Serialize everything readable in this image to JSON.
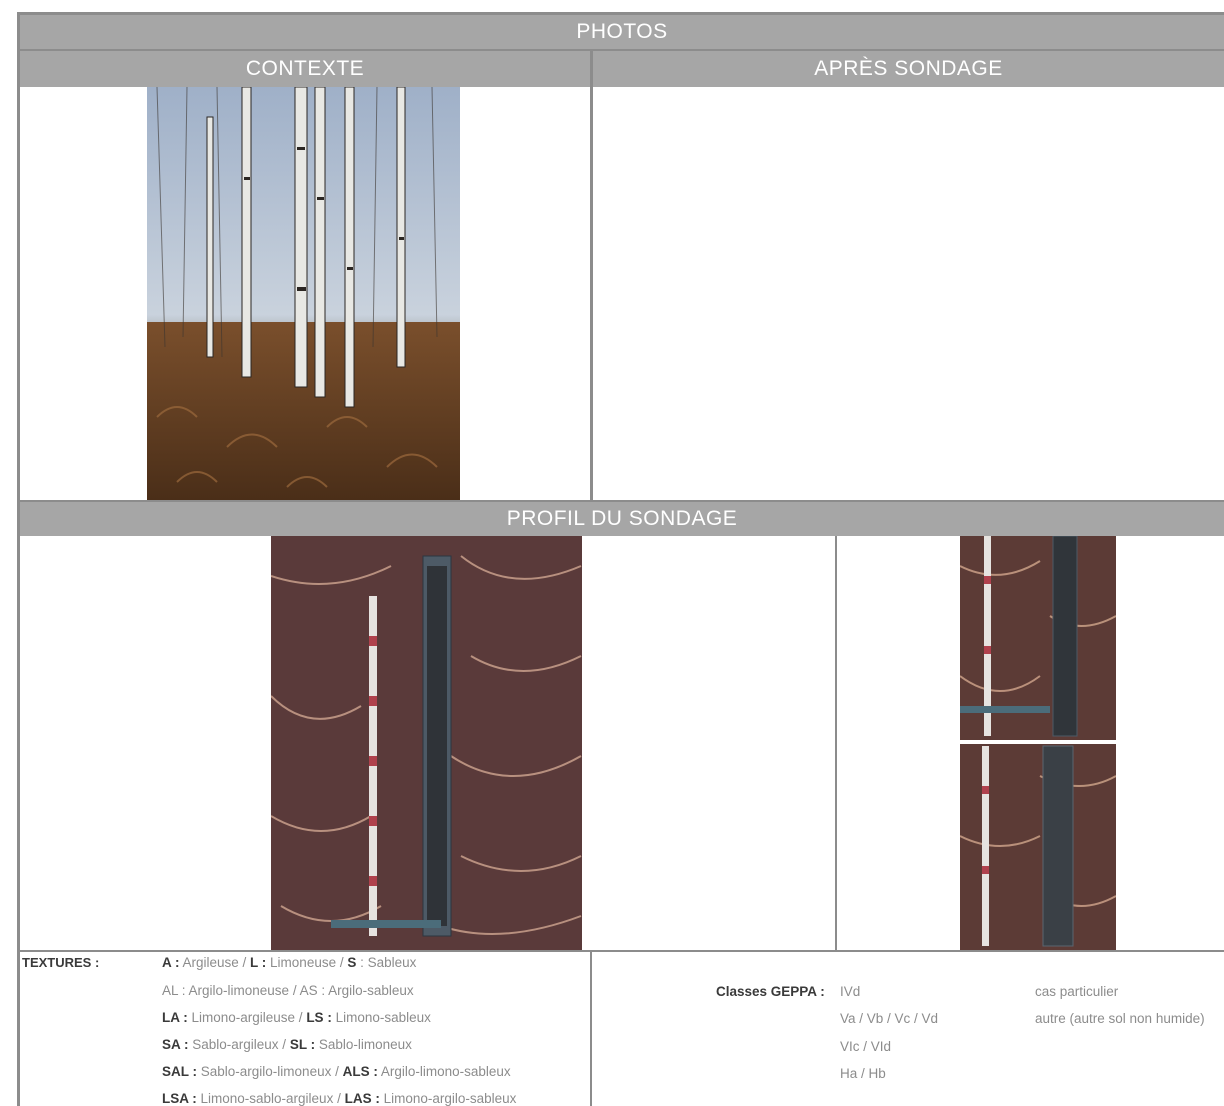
{
  "sections": {
    "photos": "PHOTOS",
    "contexte": "CONTEXTE",
    "apres_sondage": "APRÈS SONDAGE",
    "profil": "PROFIL DU SONDAGE"
  },
  "textures": {
    "label": "TEXTURES :",
    "lines": [
      [
        {
          "code": "A :",
          "name": " Argileuse / "
        },
        {
          "code": "L :",
          "name": " Limoneuse / "
        },
        {
          "code": "S",
          "name": " : Sableux"
        }
      ],
      [
        {
          "code": "",
          "name": "AL : Argilo-limoneuse / AS : Argilo-sableux"
        }
      ],
      [
        {
          "code": "LA :",
          "name": " Limono-argileuse / "
        },
        {
          "code": "LS :",
          "name": " Limono-sableux"
        }
      ],
      [
        {
          "code": "SA :",
          "name": " Sablo-argileux / "
        },
        {
          "code": "SL :",
          "name": " Sablo-limoneux"
        }
      ],
      [
        {
          "code": "SAL :",
          "name": " Sablo-argilo-limoneux  / "
        },
        {
          "code": "ALS :",
          "name": " Argilo-limono-sableux"
        }
      ],
      [
        {
          "code": "LSA :",
          "name": " Limono-sablo-argileux / "
        },
        {
          "code": "LAS :",
          "name": " Limono-argilo-sableux"
        }
      ]
    ]
  },
  "geppa": {
    "label": "Classes GEPPA :",
    "classes": [
      "IVd",
      "Va / Vb / Vc / Vd",
      "VIc / VId",
      "Ha / Hb"
    ],
    "others": [
      "cas particulier",
      "autre (autre sol non humide)"
    ]
  }
}
